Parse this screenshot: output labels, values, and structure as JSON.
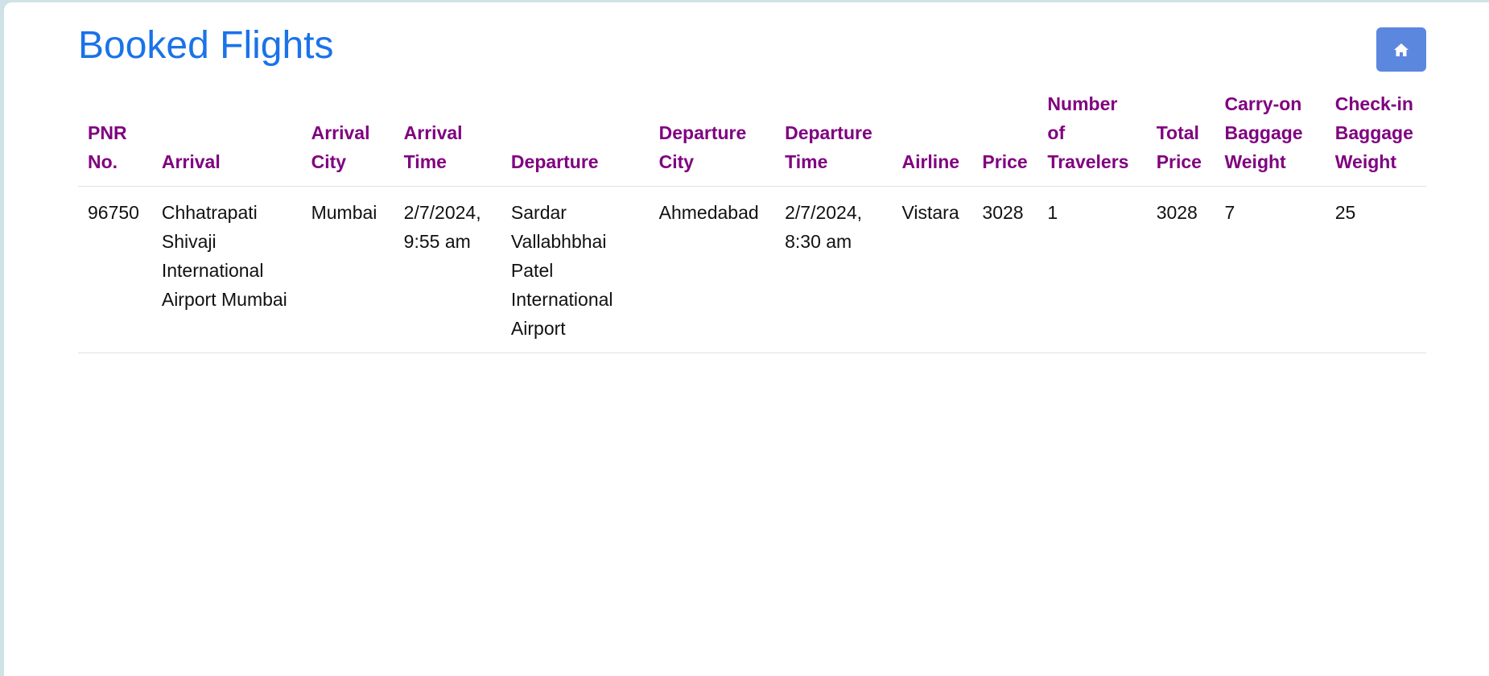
{
  "page": {
    "title": "Booked Flights",
    "home_icon": "home-icon"
  },
  "colors": {
    "title": "#1a73e8",
    "header_text": "#800080",
    "home_button_bg": "#5b87df"
  },
  "table": {
    "headers": [
      "PNR No.",
      "Arrival",
      "Arrival City",
      "Arrival Time",
      "Departure",
      "Departure City",
      "Departure Time",
      "Airline",
      "Price",
      "Number of Travelers",
      "Total Price",
      "Carry-on Baggage Weight",
      "Check-in Baggage Weight"
    ],
    "rows": [
      [
        "96750",
        "Chhatrapati Shivaji International Airport Mumbai",
        "Mumbai",
        "2/7/2024, 9:55 am",
        "Sardar Vallabhbhai Patel International Airport",
        "Ahmedabad",
        "2/7/2024, 8:30 am",
        "Vistara",
        "3028",
        "1",
        "3028",
        "7",
        "25"
      ]
    ]
  }
}
